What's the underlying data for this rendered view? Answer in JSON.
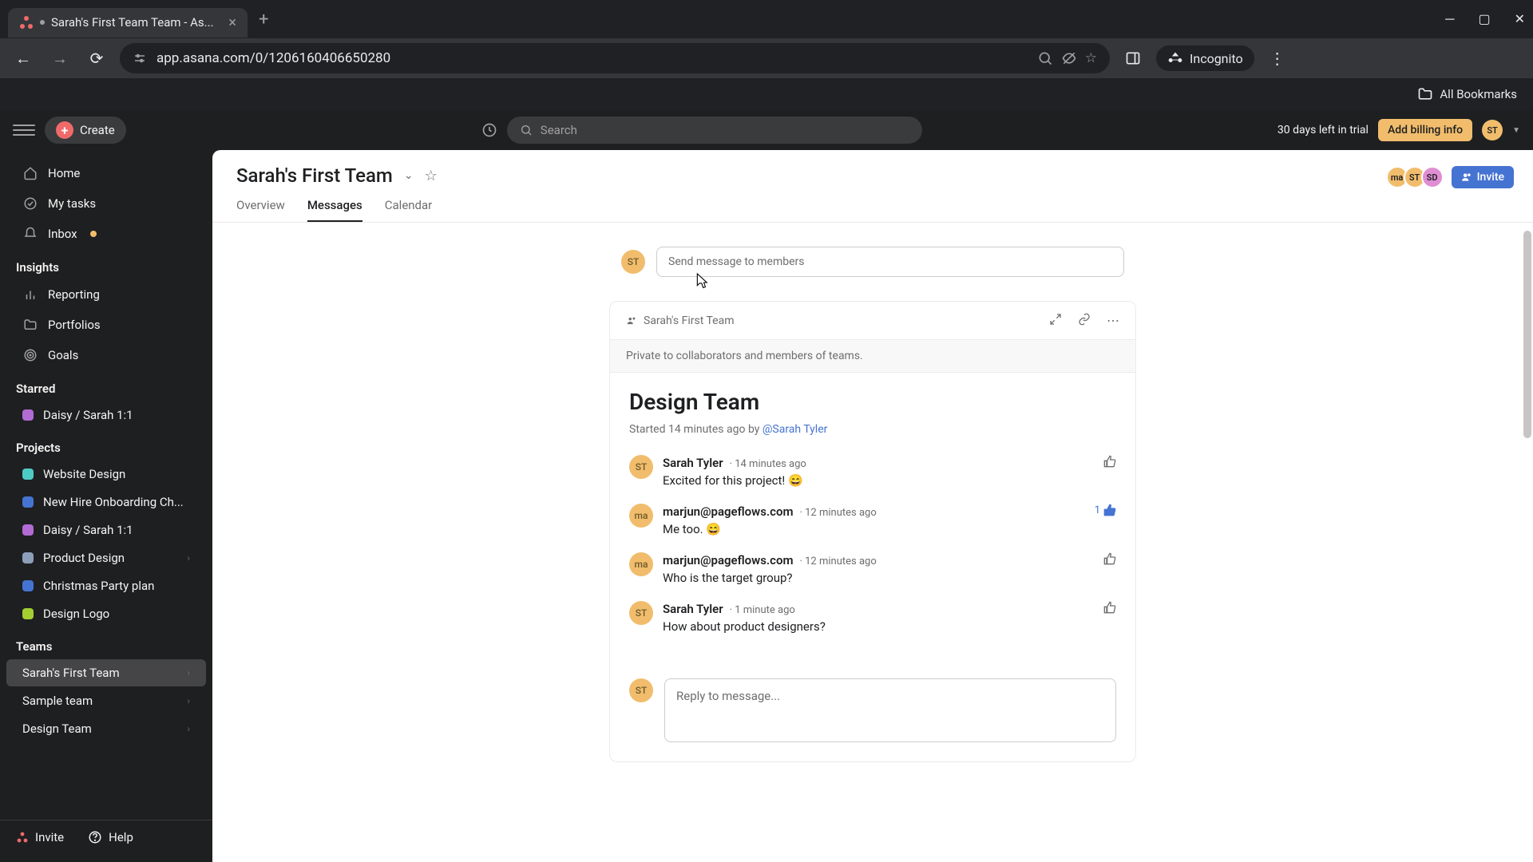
{
  "browser": {
    "tab_title": "Sarah's First Team Team - As...",
    "url": "app.asana.com/0/1206160406650280",
    "incognito": "Incognito",
    "bookmarks": "All Bookmarks"
  },
  "header": {
    "create": "Create",
    "search_placeholder": "Search",
    "trial": "30 days left in trial",
    "billing": "Add billing info",
    "user_initials": "ST"
  },
  "sidebar": {
    "home": "Home",
    "my_tasks": "My tasks",
    "inbox": "Inbox",
    "insights": "Insights",
    "reporting": "Reporting",
    "portfolios": "Portfolios",
    "goals": "Goals",
    "starred": "Starred",
    "starred_items": [
      {
        "label": "Daisy / Sarah 1:1",
        "color": "#b36bd4"
      }
    ],
    "projects": "Projects",
    "project_items": [
      {
        "label": "Website Design",
        "color": "#4ecbc4"
      },
      {
        "label": "New Hire Onboarding Ch...",
        "color": "#4573d2"
      },
      {
        "label": "Daisy / Sarah 1:1",
        "color": "#b36bd4"
      },
      {
        "label": "Product Design",
        "color": "#8d9fb8"
      },
      {
        "label": "Christmas Party plan",
        "color": "#4573d2"
      },
      {
        "label": "Design Logo",
        "color": "#a4cf30"
      }
    ],
    "teams": "Teams",
    "team_items": [
      {
        "label": "Sarah's First Team"
      },
      {
        "label": "Sample team"
      },
      {
        "label": "Design Team"
      }
    ],
    "invite": "Invite",
    "help": "Help"
  },
  "page": {
    "title": "Sarah's First Team",
    "tabs": {
      "overview": "Overview",
      "messages": "Messages",
      "calendar": "Calendar"
    },
    "invite": "Invite",
    "members": [
      {
        "initials": "ma",
        "bg": "#f1bd6c"
      },
      {
        "initials": "ST",
        "bg": "#f1bd6c"
      },
      {
        "initials": "SD",
        "bg": "#e08ed4"
      }
    ]
  },
  "compose_placeholder": "Send message to members",
  "thread": {
    "team_label": "Sarah's First Team",
    "privacy": "Private to collaborators and members of teams.",
    "title": "Design Team",
    "started_prefix": "Started 14 minutes ago by ",
    "started_by": "@Sarah Tyler",
    "messages": [
      {
        "author": "Sarah Tyler",
        "time": "14 minutes ago",
        "text": "Excited for this project! 😄",
        "avatar": "ST",
        "avatar_bg": "#f1bd6c",
        "likes": 0,
        "liked": false
      },
      {
        "author": "marjun@pageflows.com",
        "time": "12 minutes ago",
        "text": "Me too. 😄",
        "avatar": "ma",
        "avatar_bg": "#f1bd6c",
        "likes": 1,
        "liked": true
      },
      {
        "author": "marjun@pageflows.com",
        "time": "12 minutes ago",
        "text": "Who is the target group?",
        "avatar": "ma",
        "avatar_bg": "#f1bd6c",
        "likes": 0,
        "liked": false
      },
      {
        "author": "Sarah Tyler",
        "time": "1 minute ago",
        "text": "How about product designers?",
        "avatar": "ST",
        "avatar_bg": "#f1bd6c",
        "likes": 0,
        "liked": false
      }
    ],
    "reply_placeholder": "Reply to message..."
  }
}
